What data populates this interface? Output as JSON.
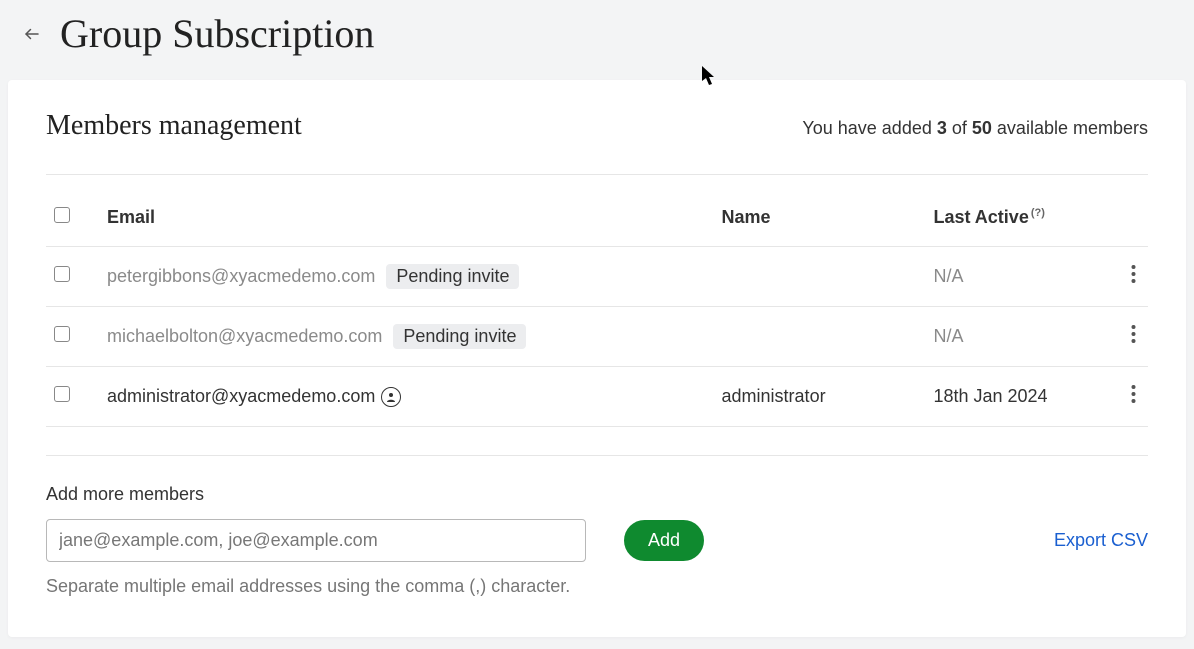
{
  "header": {
    "title": "Group Subscription"
  },
  "section": {
    "title": "Members management",
    "count_prefix": "You have added ",
    "count_added": "3",
    "count_of": " of ",
    "count_total": "50",
    "count_suffix": " available members"
  },
  "table": {
    "headers": {
      "email": "Email",
      "name": "Name",
      "last_active": "Last Active",
      "help": "(?)"
    },
    "rows": [
      {
        "email": "petergibbons@xyacmedemo.com",
        "status": "Pending invite",
        "name": "",
        "last_active": "N/A",
        "pending": true,
        "owner": false
      },
      {
        "email": "michaelbolton@xyacmedemo.com",
        "status": "Pending invite",
        "name": "",
        "last_active": "N/A",
        "pending": true,
        "owner": false
      },
      {
        "email": "administrator@xyacmedemo.com",
        "status": "",
        "name": "administrator",
        "last_active": "18th Jan 2024",
        "pending": false,
        "owner": true
      }
    ]
  },
  "add": {
    "label": "Add more members",
    "placeholder": "jane@example.com, joe@example.com",
    "button": "Add",
    "hint": "Separate multiple email addresses using the comma (,) character."
  },
  "export": {
    "label": "Export CSV"
  }
}
